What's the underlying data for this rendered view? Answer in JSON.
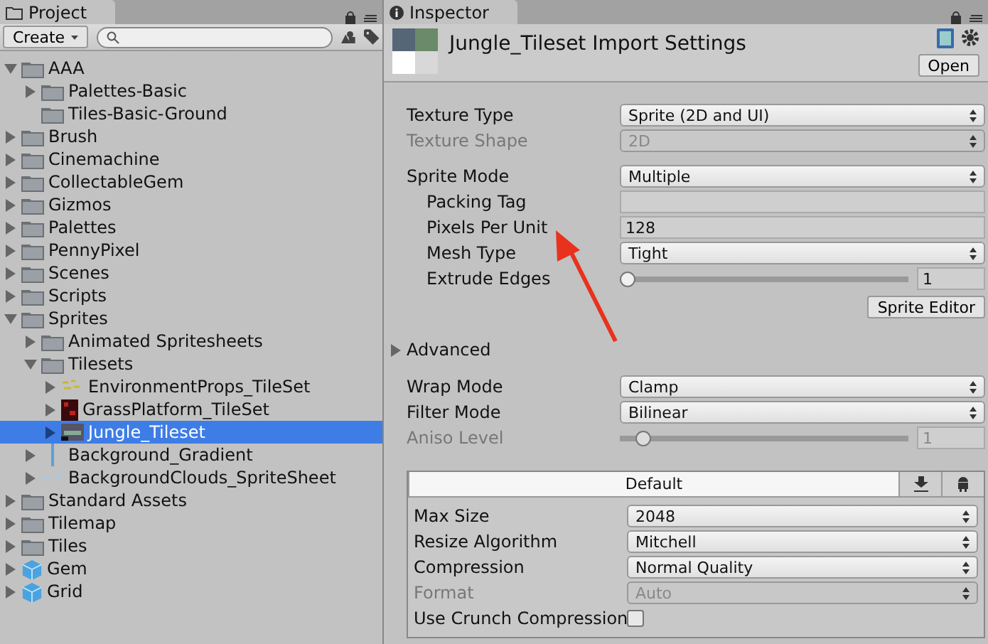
{
  "project": {
    "tab": "Project",
    "create": "Create",
    "tree": [
      {
        "label": "AAA",
        "kind": "folder",
        "expanded": true,
        "selected": false,
        "children": [
          {
            "label": "Palettes-Basic",
            "kind": "folder",
            "expanded": false,
            "selected": false,
            "has_children": true
          },
          {
            "label": "Tiles-Basic-Ground",
            "kind": "folder",
            "expanded": false,
            "selected": false,
            "has_children": false
          }
        ]
      },
      {
        "label": "Brush",
        "kind": "folder",
        "expanded": false,
        "selected": false,
        "has_children": true
      },
      {
        "label": "Cinemachine",
        "kind": "folder",
        "expanded": false,
        "selected": false,
        "has_children": true
      },
      {
        "label": "CollectableGem",
        "kind": "folder",
        "expanded": false,
        "selected": false,
        "has_children": true
      },
      {
        "label": "Gizmos",
        "kind": "folder",
        "expanded": false,
        "selected": false,
        "has_children": true
      },
      {
        "label": "Palettes",
        "kind": "folder",
        "expanded": false,
        "selected": false,
        "has_children": true
      },
      {
        "label": "PennyPixel",
        "kind": "folder",
        "expanded": false,
        "selected": false,
        "has_children": true
      },
      {
        "label": "Scenes",
        "kind": "folder",
        "expanded": false,
        "selected": false,
        "has_children": true
      },
      {
        "label": "Scripts",
        "kind": "folder",
        "expanded": false,
        "selected": false,
        "has_children": true
      },
      {
        "label": "Sprites",
        "kind": "folder",
        "expanded": true,
        "selected": false,
        "children": [
          {
            "label": "Animated Spritesheets",
            "kind": "folder",
            "expanded": false,
            "selected": false,
            "has_children": true
          },
          {
            "label": "Tilesets",
            "kind": "folder",
            "expanded": true,
            "selected": false,
            "children": [
              {
                "label": "EnvironmentProps_TileSet",
                "kind": "props",
                "expanded": false,
                "selected": false,
                "has_children": true
              },
              {
                "label": "GrassPlatform_TileSet",
                "kind": "grass",
                "expanded": false,
                "selected": false,
                "has_children": true
              },
              {
                "label": "Jungle_Tileset",
                "kind": "jungle",
                "expanded": false,
                "selected": true,
                "has_children": true
              }
            ]
          },
          {
            "label": "Background_Gradient",
            "kind": "gradient",
            "expanded": false,
            "selected": false,
            "has_children": true
          },
          {
            "label": "BackgroundClouds_SpriteSheet",
            "kind": "clouds",
            "expanded": false,
            "selected": false,
            "has_children": true
          }
        ]
      },
      {
        "label": "Standard Assets",
        "kind": "folder",
        "expanded": false,
        "selected": false,
        "has_children": true
      },
      {
        "label": "Tilemap",
        "kind": "folder",
        "expanded": false,
        "selected": false,
        "has_children": true
      },
      {
        "label": "Tiles",
        "kind": "folder",
        "expanded": false,
        "selected": false,
        "has_children": true
      },
      {
        "label": "Gem",
        "kind": "prefab",
        "expanded": false,
        "selected": false,
        "has_children": true
      },
      {
        "label": "Grid",
        "kind": "prefab",
        "expanded": false,
        "selected": false,
        "has_children": true
      }
    ]
  },
  "inspector": {
    "tab": "Inspector",
    "title": "Jungle_Tileset Import Settings",
    "open": "Open",
    "groups": [
      [
        {
          "label": "Texture Type",
          "kind": "dropdown",
          "value": "Sprite (2D and UI)",
          "disabled": false
        },
        {
          "label": "Texture Shape",
          "kind": "dropdown",
          "value": "2D",
          "disabled": true
        }
      ],
      [
        {
          "label": "Sprite Mode",
          "kind": "dropdown",
          "value": "Multiple",
          "disabled": false,
          "children": [
            {
              "label": "Packing Tag",
              "kind": "text",
              "disabled": false
            },
            {
              "label": "Pixels Per Unit",
              "kind": "text",
              "value": "128",
              "disabled": false
            },
            {
              "label": "Mesh Type",
              "kind": "dropdown",
              "value": "Tight",
              "disabled": false
            },
            {
              "label": "Extrude Edges",
              "kind": "slider",
              "value": "1",
              "level": 0.02,
              "disabled": false
            }
          ]
        }
      ]
    ],
    "sprite_editor": "Sprite Editor",
    "advanced": {
      "label": "Advanced",
      "expanded": false
    },
    "wrap_rows": [
      {
        "label": "Wrap Mode",
        "kind": "dropdown",
        "value": "Clamp",
        "disabled": false
      },
      {
        "label": "Filter Mode",
        "kind": "dropdown",
        "value": "Bilinear",
        "disabled": false
      },
      {
        "label": "Aniso Level",
        "kind": "slider",
        "value": "1",
        "level": 0.08,
        "disabled": true
      }
    ],
    "platform": {
      "tabs": [
        {
          "kind": "label",
          "label": "Default",
          "selected": true
        },
        {
          "kind": "download",
          "selected": false
        },
        {
          "kind": "android",
          "selected": false
        }
      ],
      "rows": [
        {
          "label": "Max Size",
          "kind": "dropdown",
          "value": "2048",
          "disabled": false
        },
        {
          "label": "Resize Algorithm",
          "kind": "dropdown",
          "value": "Mitchell",
          "disabled": false
        },
        {
          "label": "Compression",
          "kind": "dropdown",
          "value": "Normal Quality",
          "disabled": false
        },
        {
          "label": "Format",
          "kind": "dropdown",
          "value": "Auto",
          "disabled": true
        },
        {
          "label": "Use Crunch Compression",
          "kind": "checkbox",
          "checked": false,
          "disabled": false
        }
      ]
    }
  }
}
